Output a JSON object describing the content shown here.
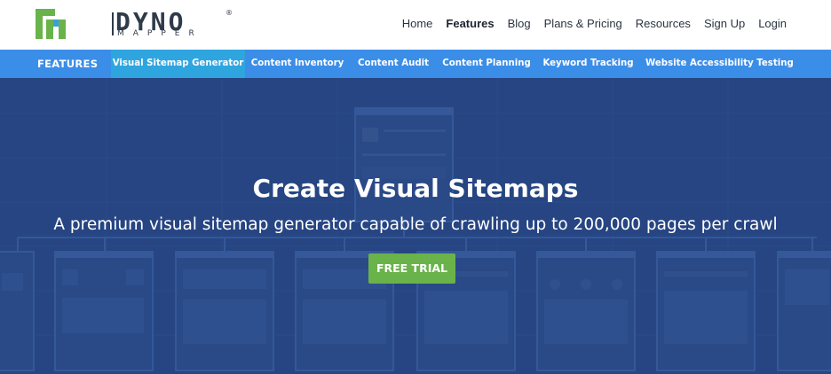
{
  "brand": {
    "name": "DYNO",
    "sub": "MAPPER",
    "registered": "®",
    "colors": {
      "green": "#6ab34a",
      "blue": "#3b8ee8",
      "dark": "#2f3a4a"
    }
  },
  "mainnav": {
    "items": [
      {
        "label": "Home",
        "active": false
      },
      {
        "label": "Features",
        "active": true
      },
      {
        "label": "Blog",
        "active": false
      },
      {
        "label": "Plans & Pricing",
        "active": false
      },
      {
        "label": "Resources",
        "active": false
      },
      {
        "label": "Sign Up",
        "active": false
      },
      {
        "label": "Login",
        "active": false
      }
    ]
  },
  "subnav": {
    "label": "FEATURES",
    "items": [
      {
        "label": "Visual Sitemap Generator",
        "active": true
      },
      {
        "label": "Content Inventory",
        "active": false
      },
      {
        "label": "Content Audit",
        "active": false
      },
      {
        "label": "Content Planning",
        "active": false
      },
      {
        "label": "Keyword Tracking",
        "active": false
      },
      {
        "label": "Website Accessibility Testing",
        "active": false
      }
    ]
  },
  "hero": {
    "title": "Create Visual Sitemaps",
    "subtitle": "A premium visual sitemap generator capable of crawling up to 200,000 pages per crawl",
    "cta": "FREE TRIAL",
    "colors": {
      "background": "#2c4f8f",
      "cta": "#6ab34a"
    }
  }
}
